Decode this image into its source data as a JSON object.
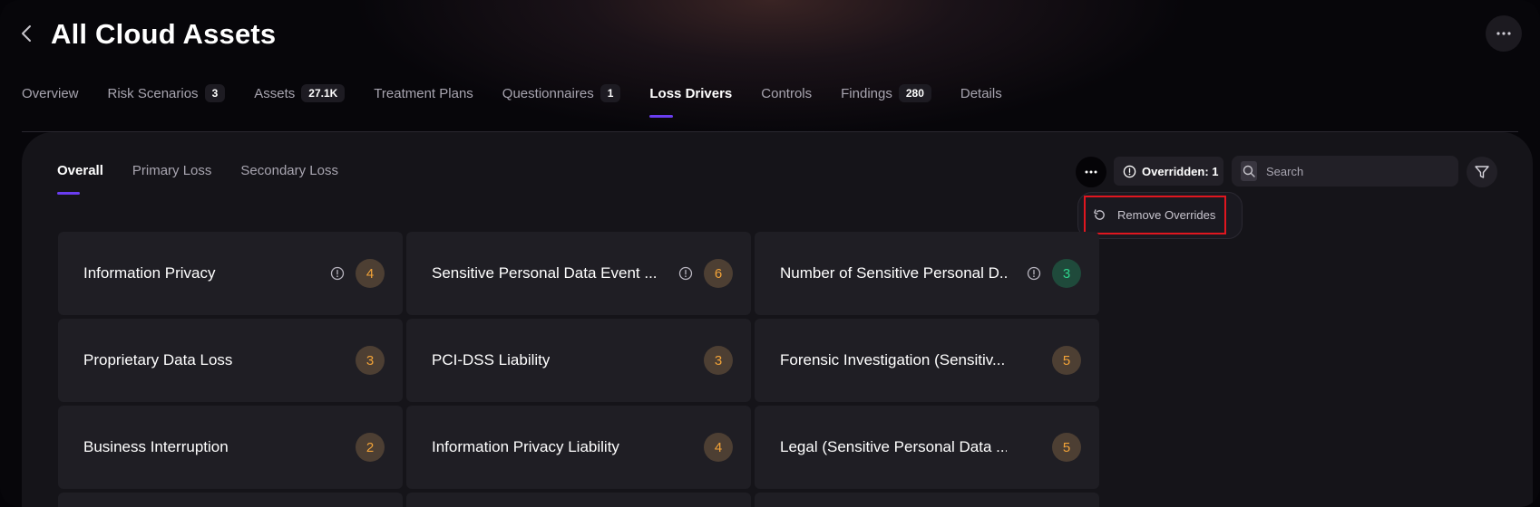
{
  "header": {
    "title": "All Cloud Assets"
  },
  "tabs": [
    {
      "label": "Overview",
      "count": null,
      "active": false
    },
    {
      "label": "Risk Scenarios",
      "count": "3",
      "active": false
    },
    {
      "label": "Assets",
      "count": "27.1K",
      "active": false
    },
    {
      "label": "Treatment Plans",
      "count": null,
      "active": false
    },
    {
      "label": "Questionnaires",
      "count": "1",
      "active": false
    },
    {
      "label": "Loss Drivers",
      "count": null,
      "active": true
    },
    {
      "label": "Controls",
      "count": null,
      "active": false
    },
    {
      "label": "Findings",
      "count": "280",
      "active": false
    },
    {
      "label": "Details",
      "count": null,
      "active": false
    }
  ],
  "subtabs": [
    {
      "label": "Overall",
      "active": true
    },
    {
      "label": "Primary Loss",
      "active": false
    },
    {
      "label": "Secondary Loss",
      "active": false
    }
  ],
  "toolbar": {
    "overridden_label": "Overridden: 1",
    "search_placeholder": "Search"
  },
  "dropdown": {
    "remove_overrides_label": "Remove Overrides"
  },
  "cards": [
    {
      "label": "Information Privacy",
      "value": "4",
      "overridden": true,
      "color": "orange"
    },
    {
      "label": "Sensitive Personal Data Event ...",
      "value": "6",
      "overridden": true,
      "color": "orange"
    },
    {
      "label": "Number of Sensitive Personal D...",
      "value": "3",
      "overridden": true,
      "color": "green"
    },
    {
      "label": "Proprietary Data Loss",
      "value": "3",
      "overridden": false,
      "color": "orange"
    },
    {
      "label": "PCI-DSS Liability",
      "value": "3",
      "overridden": false,
      "color": "orange"
    },
    {
      "label": "Forensic Investigation (Sensitiv...",
      "value": "5",
      "overridden": false,
      "color": "orange"
    },
    {
      "label": "Business Interruption",
      "value": "2",
      "overridden": false,
      "color": "orange"
    },
    {
      "label": "Information Privacy Liability",
      "value": "4",
      "overridden": false,
      "color": "orange"
    },
    {
      "label": "Legal (Sensitive Personal Data ...",
      "value": "5",
      "overridden": false,
      "color": "orange"
    }
  ],
  "colors": {
    "accent": "#6a3df0",
    "badge_orange": "#f2a338",
    "badge_green": "#2fd48c",
    "highlight": "#e0161f"
  }
}
